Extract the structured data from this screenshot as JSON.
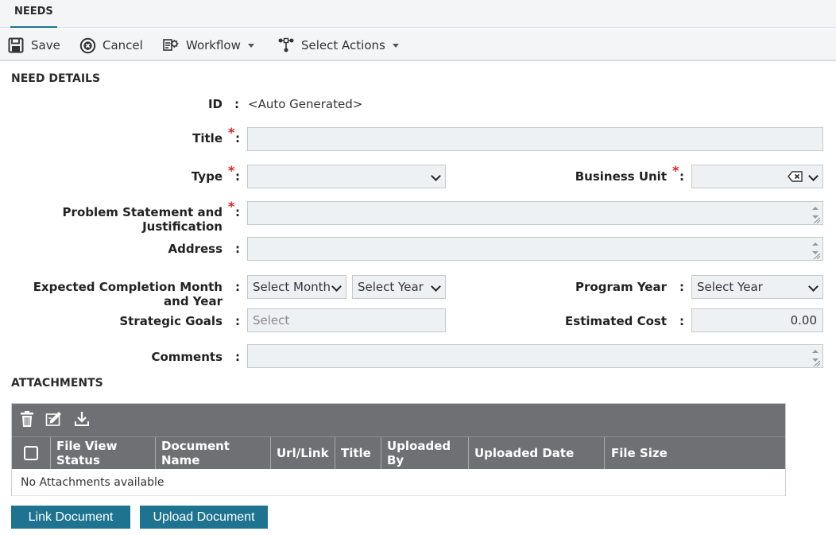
{
  "tab": {
    "label": "NEEDS"
  },
  "toolbar": {
    "save_label": "Save",
    "cancel_label": "Cancel",
    "workflow_label": "Workflow",
    "select_actions_label": "Select Actions"
  },
  "need_details": {
    "section_title": "NEED DETAILS",
    "id": {
      "label": "ID",
      "value": "<Auto Generated>"
    },
    "title": {
      "label": "Title",
      "value": ""
    },
    "type": {
      "label": "Type",
      "value": ""
    },
    "business_unit": {
      "label": "Business Unit",
      "value": ""
    },
    "problem_statement": {
      "label_line1": "Problem Statement and",
      "label_line2": "Justification",
      "value": ""
    },
    "address": {
      "label": "Address",
      "value": ""
    },
    "expected_completion": {
      "label_line1": "Expected Completion Month",
      "label_line2": "and Year",
      "month_value": "Select Month",
      "year_value": "Select Year"
    },
    "program_year": {
      "label": "Program Year",
      "value": "Select Year"
    },
    "strategic_goals": {
      "label": "Strategic Goals",
      "placeholder": "Select"
    },
    "estimated_cost": {
      "label": "Estimated Cost",
      "value": "0.00"
    },
    "comments": {
      "label": "Comments",
      "value": ""
    },
    "required_marker": "*",
    "colon": ":"
  },
  "attachments": {
    "section_title": "ATTACHMENTS",
    "columns": [
      "File View Status",
      "Document Name",
      "Url/Link",
      "Title",
      "Uploaded By",
      "Uploaded Date",
      "File Size"
    ],
    "empty_message": "No Attachments available",
    "link_document_label": "Link Document",
    "upload_document_label": "Upload Document"
  },
  "colors": {
    "accent": "#1e7391",
    "table_header": "#6f7073",
    "required": "#e02020",
    "field_bg": "#eef1f4"
  },
  "icons": [
    "save-icon",
    "cancel-icon",
    "workflow-icon",
    "select-actions-icon",
    "delete-icon",
    "edit-icon",
    "download-icon",
    "clear-icon",
    "chevron-down-icon",
    "resize-handle-icon"
  ]
}
